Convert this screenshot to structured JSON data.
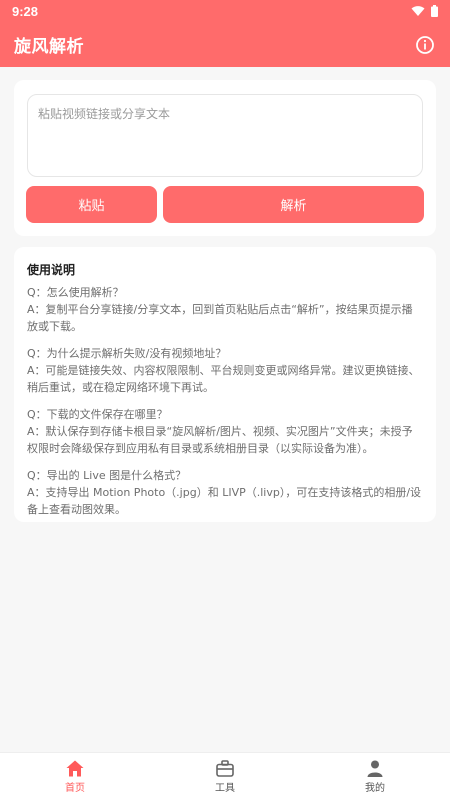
{
  "status_bar": {
    "time": "9:28"
  },
  "app_bar": {
    "title": "旋风解析"
  },
  "input_card": {
    "placeholder": "粘贴视频链接或分享文本",
    "paste_label": "粘贴",
    "parse_label": "解析"
  },
  "help": {
    "title": "使用说明",
    "items": [
      {
        "q": "Q：怎么使用解析？",
        "a": "A：复制平台分享链接/分享文本，回到首页粘贴后点击“解析”，按结果页提示播放或下载。"
      },
      {
        "q": "Q：为什么提示解析失败/没有视频地址？",
        "a": "A：可能是链接失效、内容权限限制、平台规则变更或网络异常。建议更换链接、稍后重试，或在稳定网络环境下再试。"
      },
      {
        "q": "Q：下载的文件保存在哪里？",
        "a": "A：默认保存到存储卡根目录“旋风解析/图片、视频、实况图片”文件夹；未授予权限时会降级保存到应用私有目录或系统相册目录（以实际设备为准）。"
      },
      {
        "q": "Q：导出的 Live 图是什么格式？",
        "a": "A：支持导出 Motion Photo（.jpg）和 LIVP（.livp），可在支持该格式的相册/设备上查看动图效果。"
      }
    ]
  },
  "bottom_nav": [
    {
      "label": "首页",
      "icon": "home-icon",
      "active": true
    },
    {
      "label": "工具",
      "icon": "toolbox-icon",
      "active": false
    },
    {
      "label": "我的",
      "icon": "person-icon",
      "active": false
    }
  ],
  "colors": {
    "accent": "#ff6b6b",
    "active_tab": "#ff5a5a",
    "background": "#f7f7f7"
  }
}
